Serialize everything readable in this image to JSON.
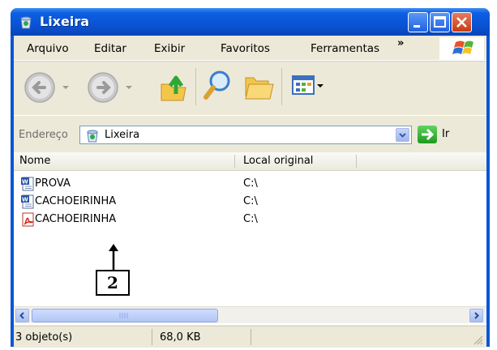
{
  "window": {
    "title": "Lixeira",
    "controls": {
      "minimize": "minimize",
      "maximize": "maximize",
      "close": "close"
    }
  },
  "menu": {
    "items": [
      "Arquivo",
      "Editar",
      "Exibir",
      "Favoritos",
      "Ferramentas"
    ],
    "overflow": "»"
  },
  "address": {
    "label": "Endereço",
    "value": "Lixeira",
    "go_label": "Ir"
  },
  "list": {
    "columns": [
      "Nome",
      "Local original"
    ],
    "rows": [
      {
        "name": "PROVA",
        "location": "C:\\",
        "icon": "word-document-icon"
      },
      {
        "name": "CACHOEIRINHA",
        "location": "C:\\",
        "icon": "word-document-icon"
      },
      {
        "name": "CACHOEIRINHA",
        "location": "C:\\",
        "icon": "pdf-document-icon"
      }
    ]
  },
  "status": {
    "objects": "3 objeto(s)",
    "size": "68,0 KB"
  },
  "annotation": {
    "label": "2"
  },
  "colors": {
    "titlebar": "#0a56d6",
    "chrome": "#ece9d8",
    "go_green": "#1e9a1e"
  }
}
